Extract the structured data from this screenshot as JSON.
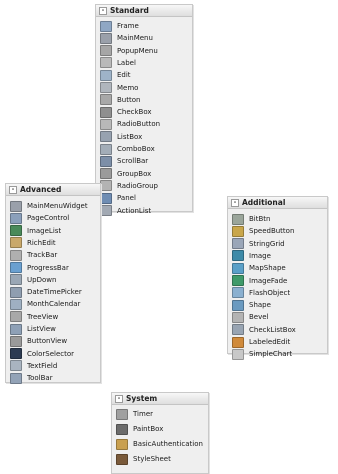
{
  "panels": {
    "standard": {
      "title": "Standard",
      "collapse": "-",
      "items": [
        {
          "label": "Frame",
          "icon": "frame-icon",
          "color": "#8fa7c4"
        },
        {
          "label": "MainMenu",
          "icon": "mainmenu-icon",
          "color": "#9aa0aa"
        },
        {
          "label": "PopupMenu",
          "icon": "popupmenu-icon",
          "color": "#a6a6a6"
        },
        {
          "label": "Label",
          "icon": "label-icon",
          "color": "#b9b9b9"
        },
        {
          "label": "Edit",
          "icon": "edit-icon",
          "color": "#9eb3c8"
        },
        {
          "label": "Memo",
          "icon": "memo-icon",
          "color": "#b0b6bd"
        },
        {
          "label": "Button",
          "icon": "button-icon",
          "color": "#a8a8a8"
        },
        {
          "label": "CheckBox",
          "icon": "checkbox-icon",
          "color": "#8f8f8f"
        },
        {
          "label": "RadioButton",
          "icon": "radiobutton-icon",
          "color": "#b8b8b8"
        },
        {
          "label": "ListBox",
          "icon": "listbox-icon",
          "color": "#97a2b0"
        },
        {
          "label": "ComboBox",
          "icon": "combobox-icon",
          "color": "#a3adb8"
        },
        {
          "label": "ScrollBar",
          "icon": "scrollbar-icon",
          "color": "#7d8fa8"
        },
        {
          "label": "GroupBox",
          "icon": "groupbox-icon",
          "color": "#9b9b9b"
        },
        {
          "label": "RadioGroup",
          "icon": "radiogroup-icon",
          "color": "#b3b3b3"
        },
        {
          "label": "Panel",
          "icon": "panel-icon",
          "color": "#6f8db3"
        },
        {
          "label": "ActionList",
          "icon": "actionlist-icon",
          "color": "#a2a9b3"
        }
      ]
    },
    "advanced": {
      "title": "Advanced",
      "collapse": "-",
      "items": [
        {
          "label": "MainMenuWidget",
          "icon": "mainmenuwidget-icon",
          "color": "#9aa0aa"
        },
        {
          "label": "PageControl",
          "icon": "pagecontrol-icon",
          "color": "#8ba0bb"
        },
        {
          "label": "ImageList",
          "icon": "imagelist-icon",
          "color": "#4a8a5a"
        },
        {
          "label": "RichEdit",
          "icon": "richedit-icon",
          "color": "#c9a86a"
        },
        {
          "label": "TrackBar",
          "icon": "trackbar-icon",
          "color": "#b0b0b0"
        },
        {
          "label": "ProgressBar",
          "icon": "progressbar-icon",
          "color": "#6aa0d0"
        },
        {
          "label": "UpDown",
          "icon": "updown-icon",
          "color": "#9aa7b5"
        },
        {
          "label": "DateTimePicker",
          "icon": "datetimepicker-icon",
          "color": "#8f9eb0"
        },
        {
          "label": "MonthCalendar",
          "icon": "monthcalendar-icon",
          "color": "#9fb0c2"
        },
        {
          "label": "TreeView",
          "icon": "treeview-icon",
          "color": "#a8a8a8"
        },
        {
          "label": "ListView",
          "icon": "listview-icon",
          "color": "#8ea0b6"
        },
        {
          "label": "ButtonView",
          "icon": "buttonview-icon",
          "color": "#9a9a9a"
        },
        {
          "label": "ColorSelector",
          "icon": "colorselector-icon",
          "color": "#2d3b52"
        },
        {
          "label": "TextField",
          "icon": "textfield-icon",
          "color": "#a9b4c0"
        },
        {
          "label": "ToolBar",
          "icon": "toolbar-icon",
          "color": "#93a3b7"
        }
      ]
    },
    "additional": {
      "title": "Additional",
      "collapse": "-",
      "items": [
        {
          "label": "BitBtn",
          "icon": "bitbtn-icon",
          "color": "#9aa59a"
        },
        {
          "label": "SpeedButton",
          "icon": "speedbutton-icon",
          "color": "#c9a64a"
        },
        {
          "label": "StringGrid",
          "icon": "stringgrid-icon",
          "color": "#9aa6b8"
        },
        {
          "label": "Image",
          "icon": "image-icon",
          "color": "#3d8aa8"
        },
        {
          "label": "MapShape",
          "icon": "mapshape-icon",
          "color": "#5aa0c8"
        },
        {
          "label": "ImageFade",
          "icon": "imagefade-icon",
          "color": "#3f9a6a"
        },
        {
          "label": "FlashObject",
          "icon": "flashobject-icon",
          "color": "#8ab0d0"
        },
        {
          "label": "Shape",
          "icon": "shape-icon",
          "color": "#6a9ac0"
        },
        {
          "label": "Bevel",
          "icon": "bevel-icon",
          "color": "#b3b3b3"
        },
        {
          "label": "CheckListBox",
          "icon": "checklistbox-icon",
          "color": "#98a4b2"
        },
        {
          "label": "LabeledEdit",
          "icon": "labelededit-icon",
          "color": "#d08a3a"
        },
        {
          "label": "SimpleChart",
          "icon": "simplechart-icon",
          "color": "#c8c8c8"
        }
      ]
    },
    "system": {
      "title": "System",
      "collapse": "-",
      "items": [
        {
          "label": "Timer",
          "icon": "timer-icon",
          "color": "#a0a0a0"
        },
        {
          "label": "PaintBox",
          "icon": "paintbox-icon",
          "color": "#6b6b6b"
        },
        {
          "label": "BasicAuthentication",
          "icon": "basicauthentication-icon",
          "color": "#c9a050"
        },
        {
          "label": "StyleSheet",
          "icon": "stylesheet-icon",
          "color": "#7a5a3a"
        }
      ]
    }
  }
}
